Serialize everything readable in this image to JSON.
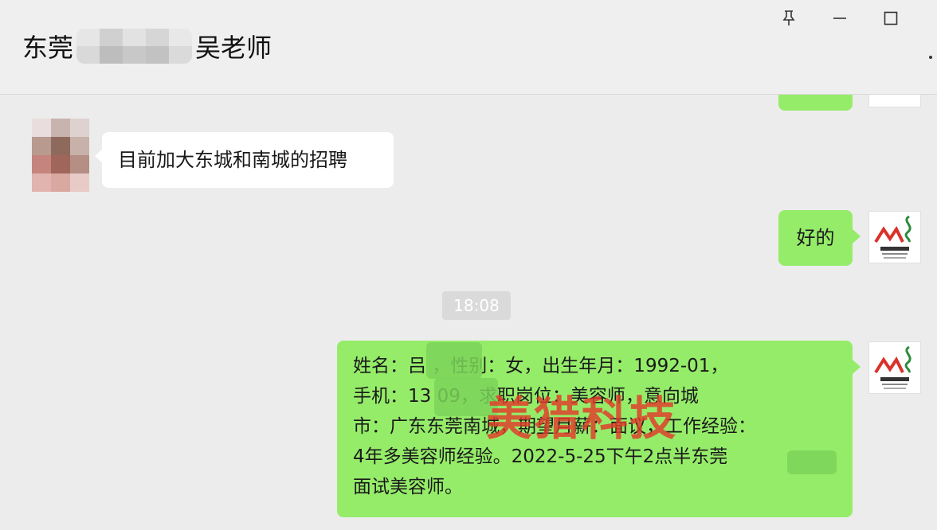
{
  "window": {
    "title_prefix": "东莞",
    "title_suffix": "吴老师",
    "pin_icon": "pin-icon",
    "minimize_icon": "minimize-icon",
    "maximize_icon": "maximize-icon"
  },
  "messages": [
    {
      "side": "left",
      "text": "目前加大东城和南城的招聘"
    },
    {
      "side": "right",
      "text": "好的"
    },
    {
      "side": "right",
      "text": "姓名：吕 ，性别：女，出生年月：1992-01，\n手机：13 09，求职岗位：美容师，意向城\n市：广东东莞南城，期望月薪：面议，工作经验：\n4年多美容师经验。2022-5-25下午2点半东莞\n面试美容师。"
    }
  ],
  "timestamp": "18:08",
  "watermark": "美猎科技",
  "colors": {
    "background": "#ececec",
    "bubble_self": "#95ec69",
    "bubble_other": "#ffffff",
    "watermark": "#e23b2a"
  }
}
